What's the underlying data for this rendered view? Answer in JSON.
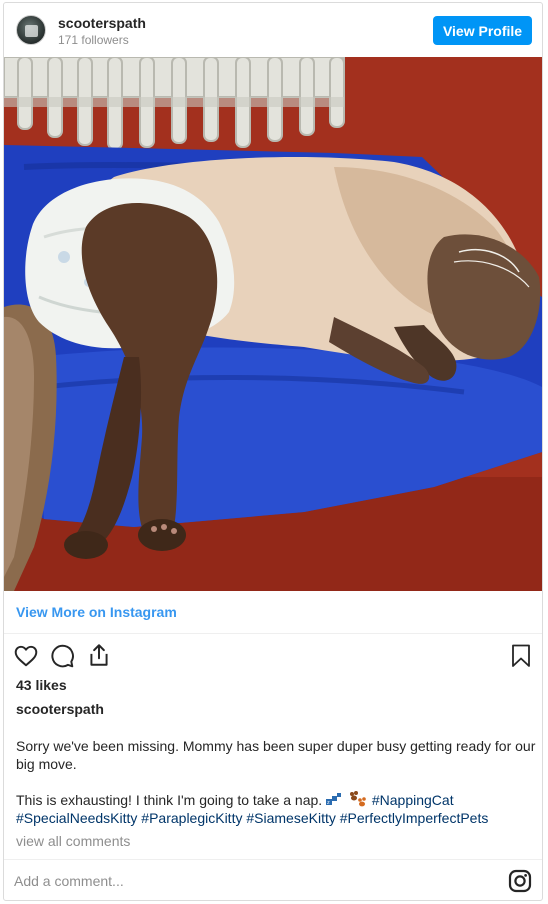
{
  "header": {
    "username": "scooterspath",
    "followers": "171 followers",
    "view_profile_label": "View Profile"
  },
  "photo": {
    "subject": "siamese-cat-napping"
  },
  "links": {
    "view_more": "View More on Instagram",
    "view_all_comments": "view all comments"
  },
  "actions": {
    "icons": [
      "heart-icon",
      "comment-icon",
      "share-icon",
      "bookmark-icon"
    ]
  },
  "post": {
    "likes": "43 likes",
    "caption_username": "scooterspath",
    "caption_line1": "Sorry we've been missing. Mommy has been super duper busy getting ready for our big move.",
    "caption_line2_text": "This is exhausting! I think I'm going to take a nap.",
    "hashtags": [
      "#NappingCat",
      "#SpecialNeedsKitty",
      "#ParaplegicKitty",
      "#SiameseKitty",
      "#PerfectlyImperfectPets"
    ]
  },
  "comment": {
    "placeholder": "Add a comment..."
  },
  "colors": {
    "accent": "#0095f6",
    "link": "#3897f0",
    "hashtag": "#003569"
  }
}
